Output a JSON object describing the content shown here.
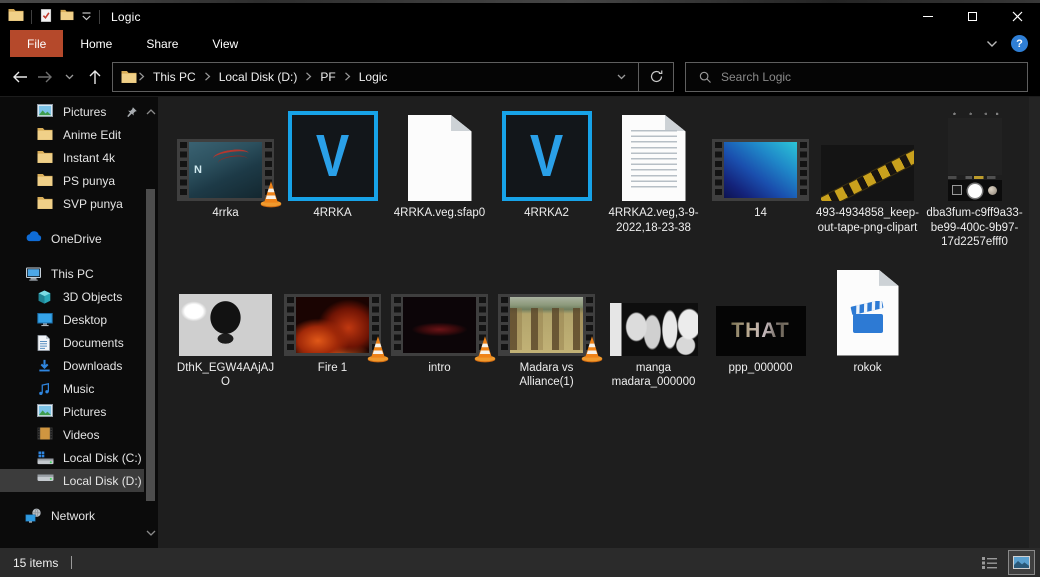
{
  "window": {
    "title": "Logic"
  },
  "titlebar": {
    "window_icon": "folder-icon",
    "qat_icons": [
      "properties-check-icon",
      "new-folder-icon",
      "qat-dropdown-icon"
    ],
    "controls": [
      "minimize",
      "maximize",
      "close"
    ]
  },
  "ribbon": {
    "tabs": [
      "File",
      "Home",
      "Share",
      "View"
    ],
    "active_tab": "File",
    "help_glyph": "?"
  },
  "navbar": {
    "breadcrumb": [
      "This PC",
      "Local Disk (D:)",
      "PF",
      "Logic"
    ],
    "search_placeholder": "Search Logic"
  },
  "sidebar": {
    "items": [
      {
        "label": "Pictures",
        "icon": "pictures",
        "level": 2,
        "pinned": true
      },
      {
        "label": "Anime Edit",
        "icon": "folder",
        "level": 2
      },
      {
        "label": "Instant 4k",
        "icon": "folder",
        "level": 2
      },
      {
        "label": "PS punya",
        "icon": "folder",
        "level": 2
      },
      {
        "label": "SVP punya",
        "icon": "folder",
        "level": 2
      },
      {
        "label": "OneDrive",
        "icon": "onedrive",
        "level": 1,
        "gap": true
      },
      {
        "label": "This PC",
        "icon": "thispc",
        "level": 1,
        "gap": true
      },
      {
        "label": "3D Objects",
        "icon": "cube",
        "level": 2
      },
      {
        "label": "Desktop",
        "icon": "desktop",
        "level": 2
      },
      {
        "label": "Documents",
        "icon": "documents",
        "level": 2
      },
      {
        "label": "Downloads",
        "icon": "downloads",
        "level": 2
      },
      {
        "label": "Music",
        "icon": "music",
        "level": 2
      },
      {
        "label": "Pictures",
        "icon": "pictures",
        "level": 2
      },
      {
        "label": "Videos",
        "icon": "videos",
        "level": 2
      },
      {
        "label": "Local Disk (C:)",
        "icon": "disk-c",
        "level": 2
      },
      {
        "label": "Local Disk (D:)",
        "icon": "disk-d",
        "level": 2,
        "selected": true
      },
      {
        "label": "Network",
        "icon": "network",
        "level": 1,
        "gap": true
      }
    ]
  },
  "files": [
    {
      "name": "4rrka",
      "kind": "film",
      "thumb": "anime",
      "vlc_badge": true,
      "overlay_text": "N"
    },
    {
      "name": "4RRKA",
      "kind": "vegas",
      "glyph": "V"
    },
    {
      "name": "4RRKA.veg.sfap0",
      "kind": "doc-blank"
    },
    {
      "name": "4RRKA2",
      "kind": "vegas",
      "glyph": "V"
    },
    {
      "name": "4RRKA2.veg,3-9-2022,18-23-38",
      "kind": "doc-text"
    },
    {
      "name": "14",
      "kind": "film",
      "thumb": "blue"
    },
    {
      "name": "493-4934858_keep-out-tape-png-clipart",
      "kind": "image",
      "thumb": "tape"
    },
    {
      "name": "dba3fum-c9ff9a33-be99-400c-9b97-17d2257efff0",
      "kind": "image",
      "thumb": "camera"
    },
    {
      "name": "DthK_EGW4AAjAJO",
      "kind": "image",
      "thumb": "manga1"
    },
    {
      "name": "Fire 1",
      "kind": "film",
      "thumb": "fire",
      "vlc_badge": true
    },
    {
      "name": "intro",
      "kind": "film",
      "thumb": "intro",
      "vlc_badge": true
    },
    {
      "name": "Madara vs Alliance(1)",
      "kind": "film",
      "thumb": "madara",
      "vlc_badge": true
    },
    {
      "name": "manga madara_000000",
      "kind": "image",
      "thumb": "manga2"
    },
    {
      "name": "ppp_000000",
      "kind": "image",
      "thumb": "that",
      "overlay_text": "THAT"
    },
    {
      "name": "rokok",
      "kind": "file-video"
    }
  ],
  "statusbar": {
    "items_text": "15 items"
  },
  "colors": {
    "accent_blue": "#17a3e8",
    "file_tab_red": "#b5492b",
    "selection_gray": "#3c3c3c",
    "help_blue": "#2f7fd6",
    "folder_yellow": "#f0d088",
    "vlc_orange": "#ef8318"
  }
}
